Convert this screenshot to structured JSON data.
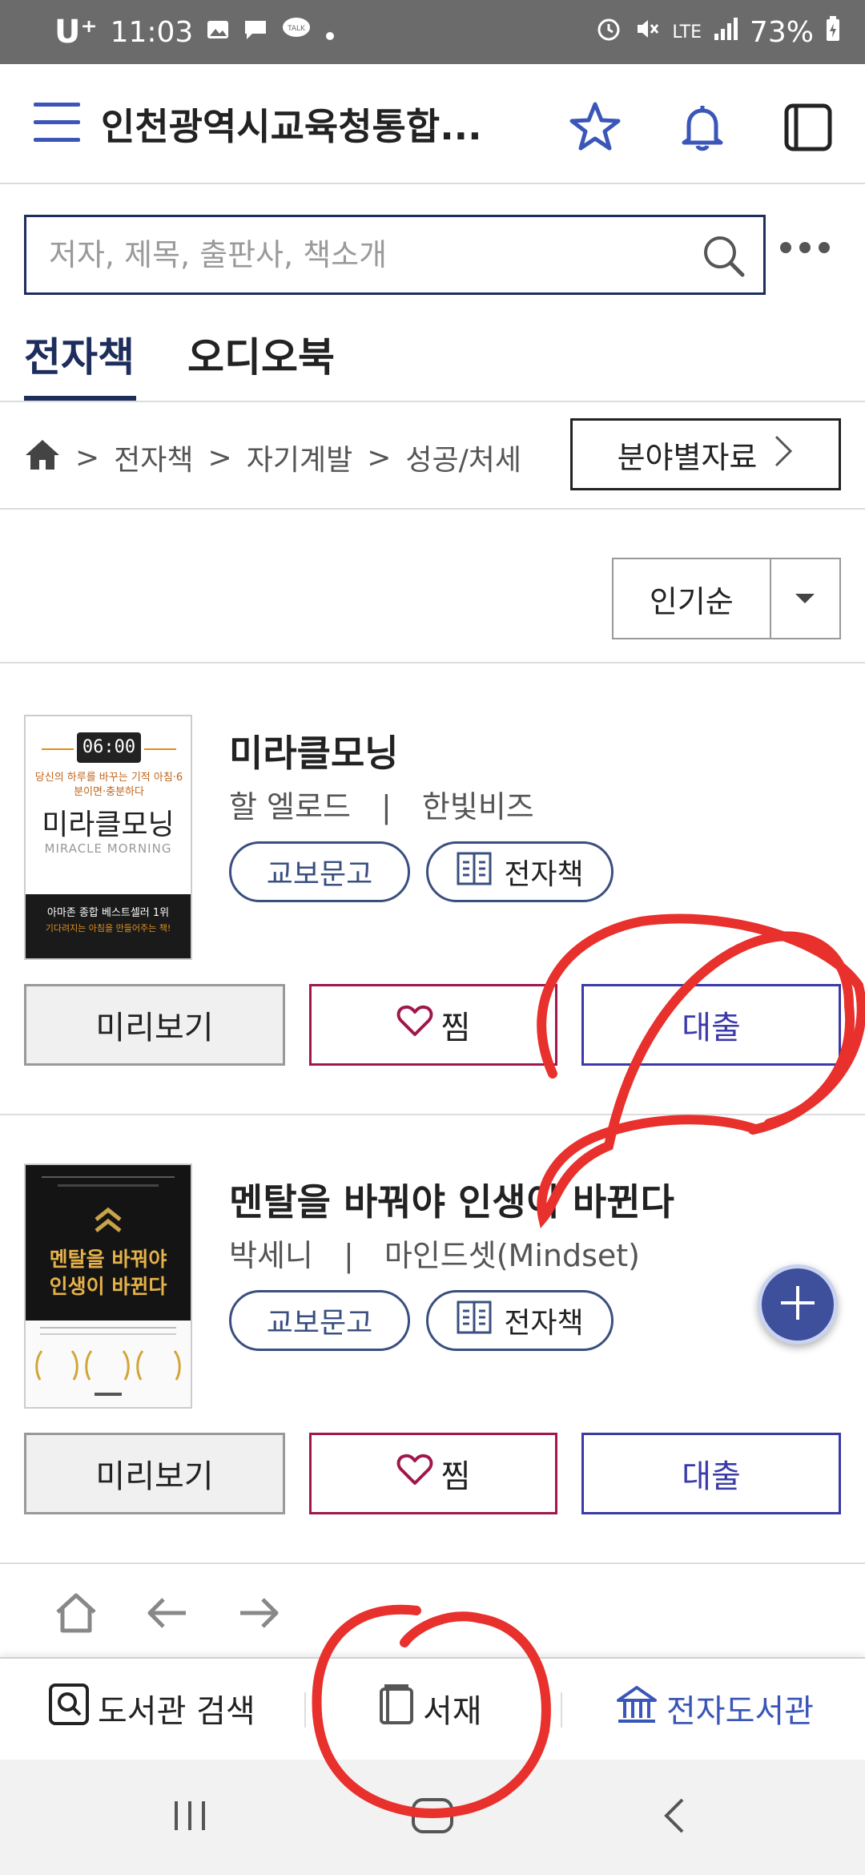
{
  "status_bar": {
    "carrier": "U⁺",
    "time": "11:03",
    "network": "LTE",
    "battery": "73%"
  },
  "header": {
    "title": "인천광역시교육청통합...",
    "icons": [
      "menu-icon",
      "star-icon",
      "bell-icon",
      "book-frame-icon"
    ]
  },
  "search": {
    "placeholder": "저자, 제목, 출판사, 책소개",
    "value": ""
  },
  "tabs": [
    {
      "label": "전자책",
      "active": true
    },
    {
      "label": "오디오북",
      "active": false
    }
  ],
  "breadcrumb": {
    "items": [
      "전자책",
      "자기계발",
      "성공/처세"
    ],
    "separator": ">"
  },
  "category_button": {
    "label": "분야별자료"
  },
  "sort": {
    "selected": "인기순"
  },
  "books": [
    {
      "title": "미라클모닝",
      "author": "할 엘로드",
      "publisher": "한빛비즈",
      "tags": [
        "교보문고",
        "전자책"
      ],
      "cover": {
        "clock": "06:00",
        "tagline": "당신의 하루를 바꾸는 기적 아침·6분이면·충분하다",
        "title": "미라클모닝",
        "subtitle": "MIRACLE MORNING",
        "band": "아마존 종합 베스트셀러 1위",
        "band_sub": "기다려지는 아침을 만들어주는 책!"
      },
      "buttons": {
        "preview": "미리보기",
        "wish": "찜",
        "loan": "대출"
      }
    },
    {
      "title": "멘탈을 바꿔야 인생이 바뀐다",
      "author": "박세니",
      "publisher": "마인드셋(Mindset)",
      "tags": [
        "교보문고",
        "전자책"
      ],
      "cover": {
        "title_line1": "멘탈을 바꿔야",
        "title_line2": "인생이 바뀐다"
      },
      "buttons": {
        "preview": "미리보기",
        "wish": "찜",
        "loan": "대출"
      }
    }
  ],
  "bottom_nav": [
    {
      "label": "도서관 검색",
      "icon": "search-book-icon"
    },
    {
      "label": "서재",
      "icon": "shelf-book-icon"
    },
    {
      "label": "전자도서관",
      "icon": "library-icon",
      "active": true
    }
  ],
  "colors": {
    "primary": "#1d2d5c",
    "accent": "#3a56b8",
    "wish": "#a0174d",
    "loan": "#3a3aa8",
    "annotation": "#e8302c"
  }
}
